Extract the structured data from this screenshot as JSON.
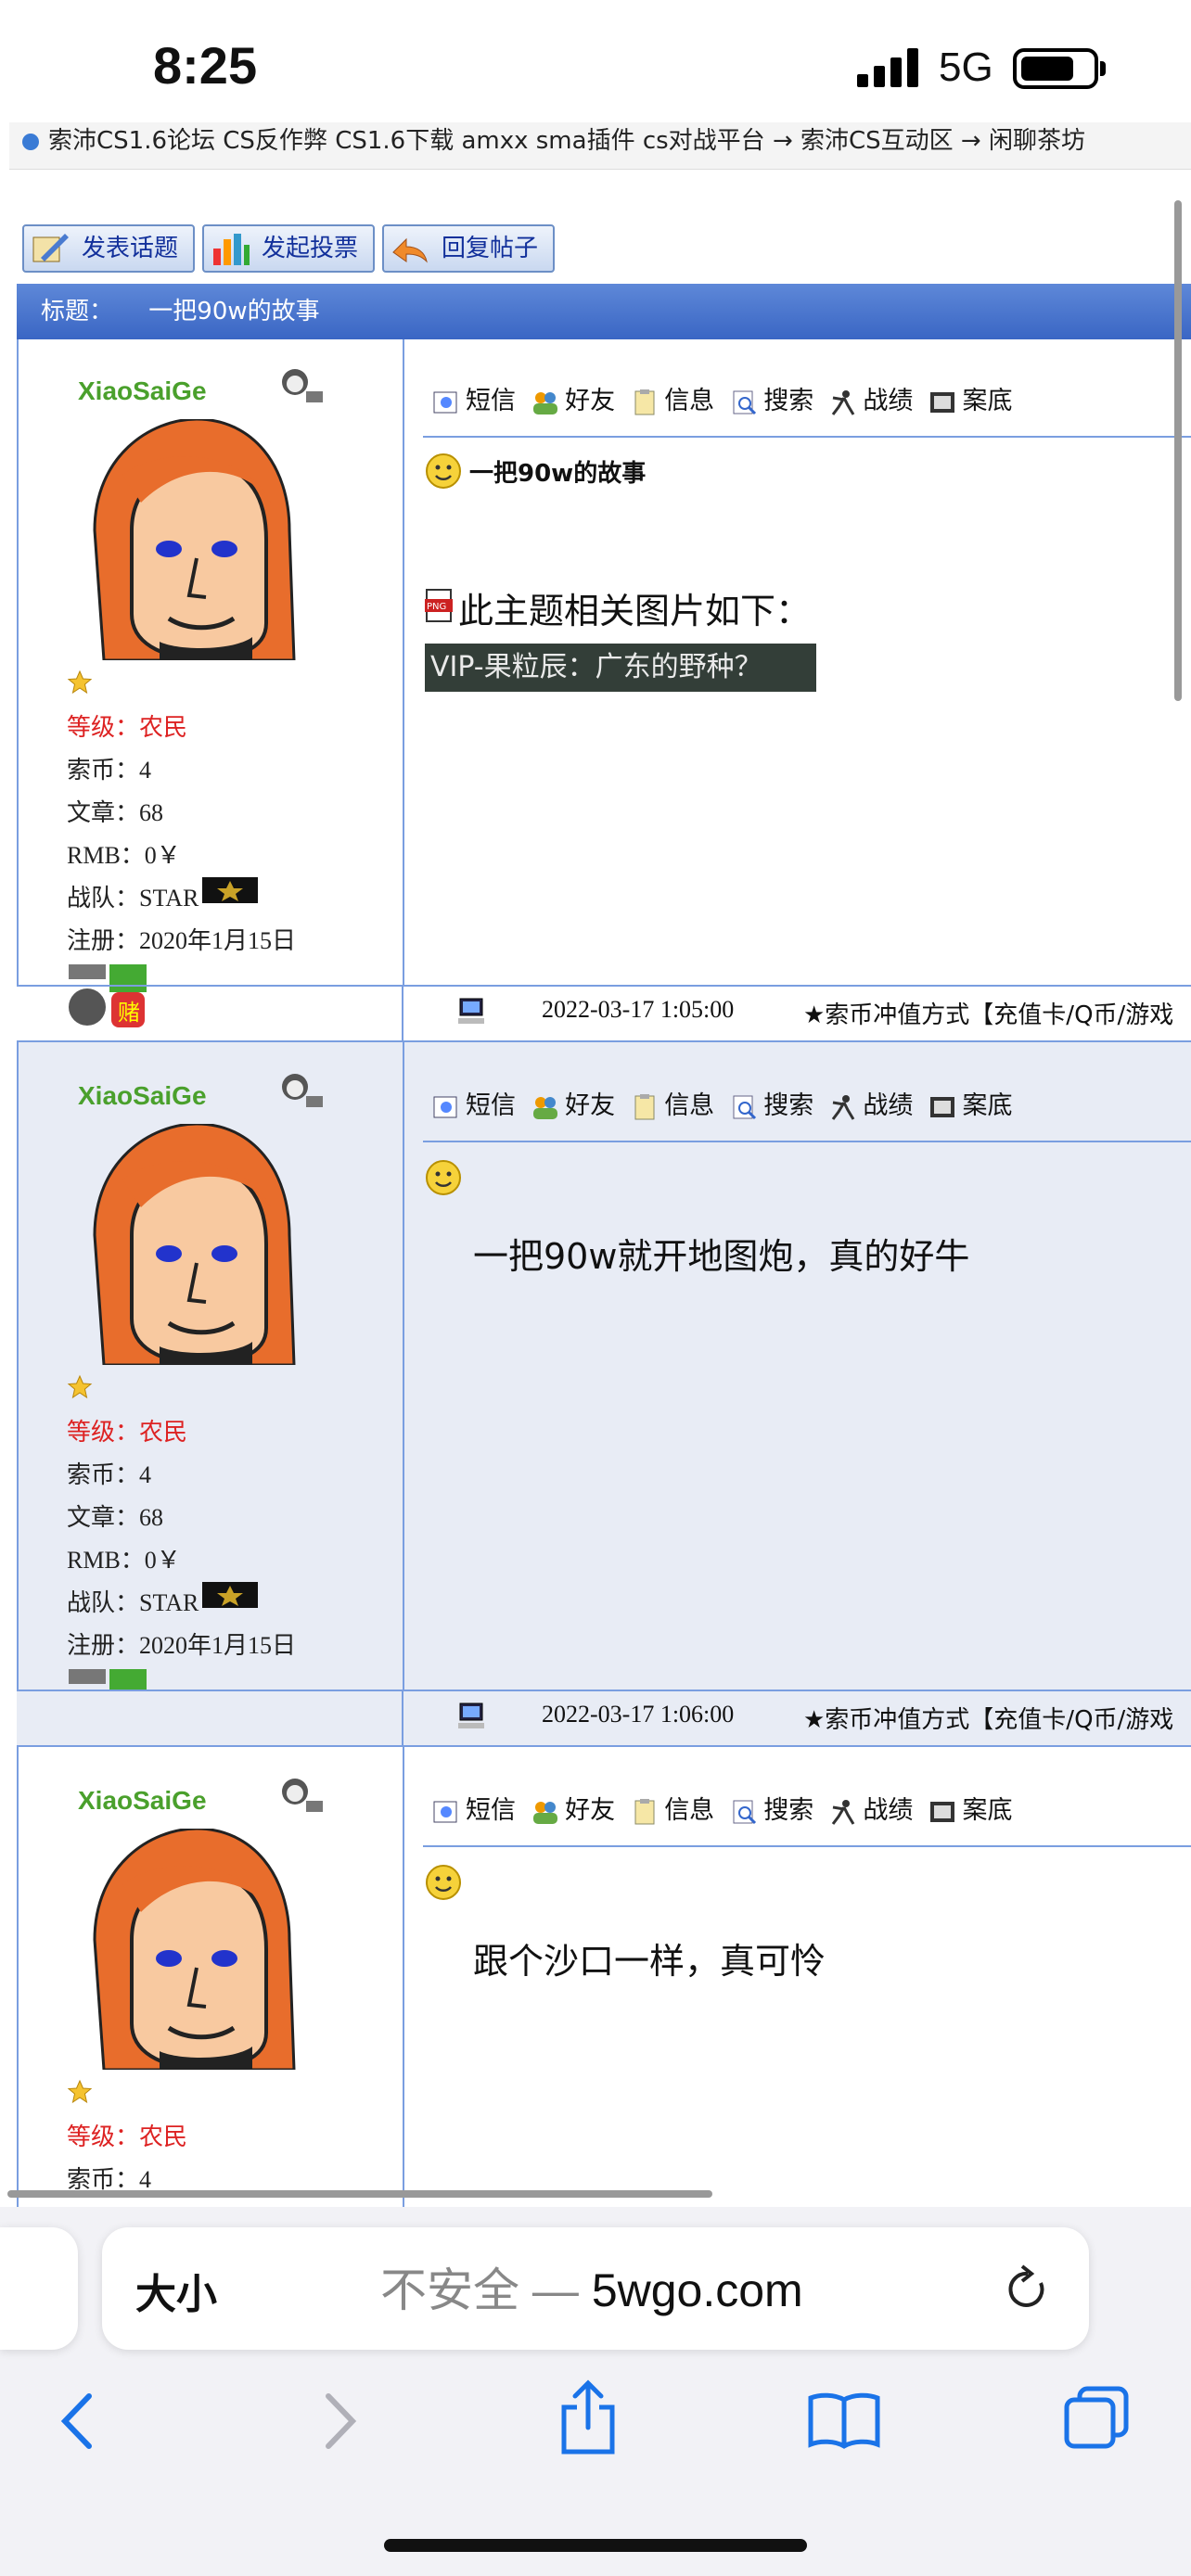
{
  "status": {
    "time": "8:25",
    "network": "5G"
  },
  "breadcrumb": "索沛CS1.6论坛 CS反作弊 CS1.6下载 amxx sma插件 cs对战平台 → 索沛CS互动区 → 闲聊茶坊",
  "toolbar": {
    "new_topic": "发表话题",
    "new_poll": "发起投票",
    "reply": "回复帖子"
  },
  "topic": {
    "label": "标题：",
    "title": "一把90w的故事"
  },
  "actions": [
    "短信",
    "好友",
    "信息",
    "搜索",
    "战绩",
    "案底"
  ],
  "posts": [
    {
      "username": "XiaoSaiGe",
      "level_label": "等级：农民",
      "coins": "索币：4",
      "articles": "文章：68",
      "rmb": "RMB：0￥",
      "team": "战队：STAR",
      "registered": "注册：2020年1月15日",
      "content_title": "一把90w的故事",
      "images_label": "此主题相关图片如下：",
      "image_caption": "VIP-果粒辰：广东的野种？",
      "time": "2022-03-17 1:05:00",
      "note": "★索币冲值方式【充值卡/Q币/游戏"
    },
    {
      "username": "XiaoSaiGe",
      "level_label": "等级：农民",
      "coins": "索币：4",
      "articles": "文章：68",
      "rmb": "RMB：0￥",
      "team": "战队：STAR",
      "registered": "注册：2020年1月15日",
      "content": "一把90w就开地图炮，真的好牛",
      "time": "2022-03-17 1:06:00",
      "note": "★索币冲值方式【充值卡/Q币/游戏"
    },
    {
      "username": "XiaoSaiGe",
      "level_label": "等级：农民",
      "coins": "索币：4",
      "content": "跟个沙口一样，真可怜"
    }
  ],
  "browser": {
    "aa": "大小",
    "insecure": "不安全 —",
    "domain": "5wgo.com"
  },
  "colors": {
    "accent": "#3a66c4",
    "username": "#4aa02c",
    "level": "#d22222"
  }
}
